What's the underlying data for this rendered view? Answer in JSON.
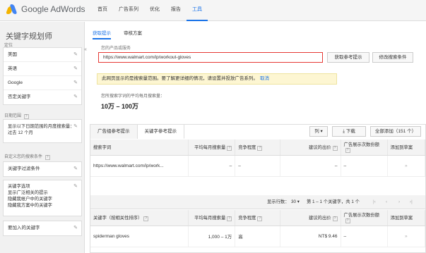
{
  "app": {
    "brand": "Google AdWords"
  },
  "nav": [
    "首页",
    "广告系列",
    "优化",
    "报告",
    "工具"
  ],
  "nav_active": 4,
  "sidebar": {
    "title": "关键字规划师",
    "section1_label": "定位",
    "targeting": [
      "美国",
      "英语",
      "Google",
      "否定关键字"
    ],
    "daterange_label": "日期范围",
    "daterange_value": "显示以下日期范围的月度搜索量：过去 12 个月",
    "filters_label": "自定义您的搜索条件",
    "filter_items": [
      "关键字过滤条件"
    ],
    "options_title": "关键字选项",
    "options_lines": [
      "显示广泛相关的提示",
      "隐藏我帐户中的关键字",
      "隐藏我方案中的关键字"
    ],
    "include_label": "要加入的关键字",
    "collapse": "«"
  },
  "main": {
    "tabs": [
      "获取提示",
      "审核方案"
    ],
    "field_label": "您的产品或服务",
    "url_value": "https://www.walmart.com/ip/workout-gloves",
    "get_ideas": "获取参考提示",
    "modify_search": "修改搜索条件",
    "notice": "此网页显示的是搜索量范围。要了解更详细的情况，请设置并投放广告系列。",
    "notice_link": "取消",
    "volume_label": "您所搜索字词的平均每月搜索量：",
    "volume_value": "10万 – 100万"
  },
  "results": {
    "tabs": [
      "广告组参考提示",
      "关键字参考提示"
    ],
    "columns_btn": "列 ▾",
    "download_btn": "下载",
    "add_all_btn": "全部添加（151 个）",
    "table1_headers": [
      "搜索字词",
      "平均每月搜索量",
      "竞争程度",
      "建议的出价",
      "广告展示次数份额",
      "添加到草案"
    ],
    "table1_row": {
      "term": "https://www.walmart.com/ip/work...",
      "volume": "–",
      "competition": "–",
      "bid": "–",
      "share": "–",
      "add": "»"
    },
    "pager": {
      "rows_label": "显示行数：",
      "rows": "30 ▾",
      "range": "第 1 – 1 个关键字，共 1 个"
    },
    "table2_headers": [
      "关键字（按相关性排序）",
      "平均每月搜索量",
      "竞争程度",
      "建议的出价",
      "广告展示次数份额",
      "添加到草案"
    ],
    "table2_row": {
      "term": "spiderman gloves",
      "volume": "1,000 – 1万",
      "competition": "高",
      "bid": "NT$ 9.46",
      "share": "–",
      "add": "»"
    }
  }
}
